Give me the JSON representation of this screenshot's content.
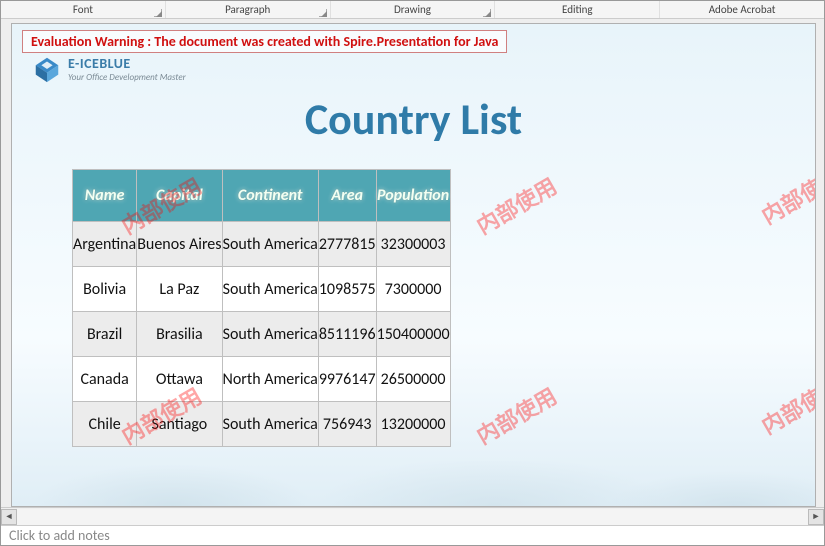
{
  "ribbon": {
    "groups": [
      "Font",
      "Paragraph",
      "Drawing",
      "Editing",
      "Adobe Acrobat"
    ]
  },
  "warning": "Evaluation Warning : The document was created with  Spire.Presentation for Java",
  "logo": {
    "brand": "E-ICEBLUE",
    "tagline": "Your Office Development Master"
  },
  "slide": {
    "title": "Country List"
  },
  "table": {
    "headers": [
      "Name",
      "Capital",
      "Continent",
      "Area",
      "Population"
    ],
    "rows": [
      [
        "Argentina",
        "Buenos Aires",
        "South America",
        "2777815",
        "32300003"
      ],
      [
        "Bolivia",
        "La Paz",
        "South America",
        "1098575",
        "7300000"
      ],
      [
        "Brazil",
        "Brasilia",
        "South America",
        "8511196",
        "150400000"
      ],
      [
        "Canada",
        "Ottawa",
        "North America",
        "9976147",
        "26500000"
      ],
      [
        "Chile",
        "Santiago",
        "South America",
        "756943",
        "13200000"
      ]
    ]
  },
  "watermark_text": "内部使用",
  "notes_placeholder": "Click to add notes",
  "chart_data": {
    "type": "table",
    "title": "Country List",
    "columns": [
      "Name",
      "Capital",
      "Continent",
      "Area",
      "Population"
    ],
    "rows": [
      {
        "Name": "Argentina",
        "Capital": "Buenos Aires",
        "Continent": "South America",
        "Area": 2777815,
        "Population": 32300003
      },
      {
        "Name": "Bolivia",
        "Capital": "La Paz",
        "Continent": "South America",
        "Area": 1098575,
        "Population": 7300000
      },
      {
        "Name": "Brazil",
        "Capital": "Brasilia",
        "Continent": "South America",
        "Area": 8511196,
        "Population": 150400000
      },
      {
        "Name": "Canada",
        "Capital": "Ottawa",
        "Continent": "North America",
        "Area": 9976147,
        "Population": 26500000
      },
      {
        "Name": "Chile",
        "Capital": "Santiago",
        "Continent": "South America",
        "Area": 756943,
        "Population": 13200000
      }
    ]
  }
}
